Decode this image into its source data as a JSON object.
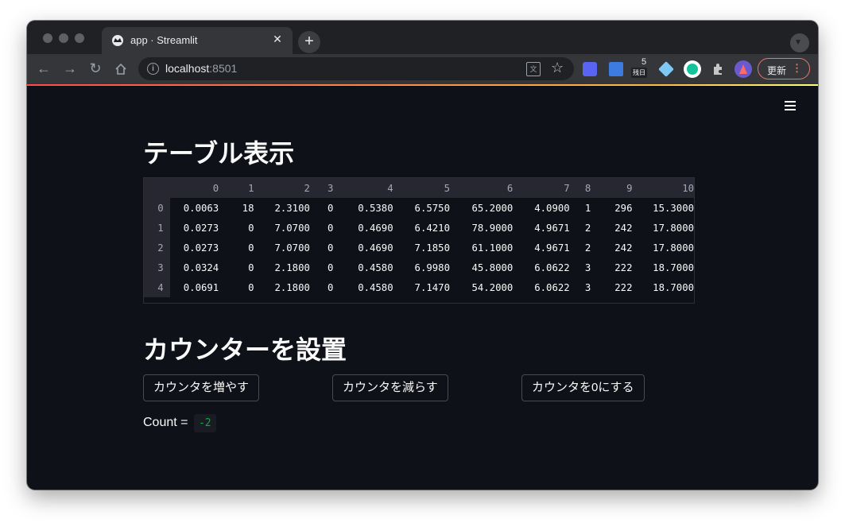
{
  "browser": {
    "tab_title": "app · Streamlit",
    "close_glyph": "✕",
    "newtab_glyph": "+",
    "url_host": "localhost",
    "url_port": ":8501",
    "badge_number": "5",
    "badge_text": "残日",
    "update_label": "更新",
    "update_menu_glyph": "⋮",
    "icons": [
      "back-icon",
      "forward-icon",
      "reload-icon",
      "home-icon",
      "info-icon",
      "translate-icon",
      "star-icon",
      "extension-icons",
      "puzzle-icon",
      "profile-avatar"
    ]
  },
  "app": {
    "table_heading": "テーブル表示",
    "counter_heading": "カウンターを設置",
    "buttons": {
      "increment": "カウンタを増やす",
      "decrement": "カウンタを減らす",
      "reset": "カウンタを0にする"
    },
    "count_label": "Count = ",
    "count_value": "-2",
    "accent": "#ff4b4b",
    "background": "#0e1117",
    "count_color": "#09ab3b"
  },
  "dataframe": {
    "columns": [
      "0",
      "1",
      "2",
      "3",
      "4",
      "5",
      "6",
      "7",
      "8",
      "9",
      "10"
    ],
    "rows": [
      {
        "index": "0",
        "cells": [
          "0.0063",
          "18",
          "2.3100",
          "0",
          "0.5380",
          "6.5750",
          "65.2000",
          "4.0900",
          "1",
          "296",
          "15.3000"
        ]
      },
      {
        "index": "1",
        "cells": [
          "0.0273",
          "0",
          "7.0700",
          "0",
          "0.4690",
          "6.4210",
          "78.9000",
          "4.9671",
          "2",
          "242",
          "17.8000"
        ]
      },
      {
        "index": "2",
        "cells": [
          "0.0273",
          "0",
          "7.0700",
          "0",
          "0.4690",
          "7.1850",
          "61.1000",
          "4.9671",
          "2",
          "242",
          "17.8000"
        ]
      },
      {
        "index": "3",
        "cells": [
          "0.0324",
          "0",
          "2.1800",
          "0",
          "0.4580",
          "6.9980",
          "45.8000",
          "6.0622",
          "3",
          "222",
          "18.7000"
        ]
      },
      {
        "index": "4",
        "cells": [
          "0.0691",
          "0",
          "2.1800",
          "0",
          "0.4580",
          "7.1470",
          "54.2000",
          "6.0622",
          "3",
          "222",
          "18.7000"
        ]
      }
    ]
  }
}
